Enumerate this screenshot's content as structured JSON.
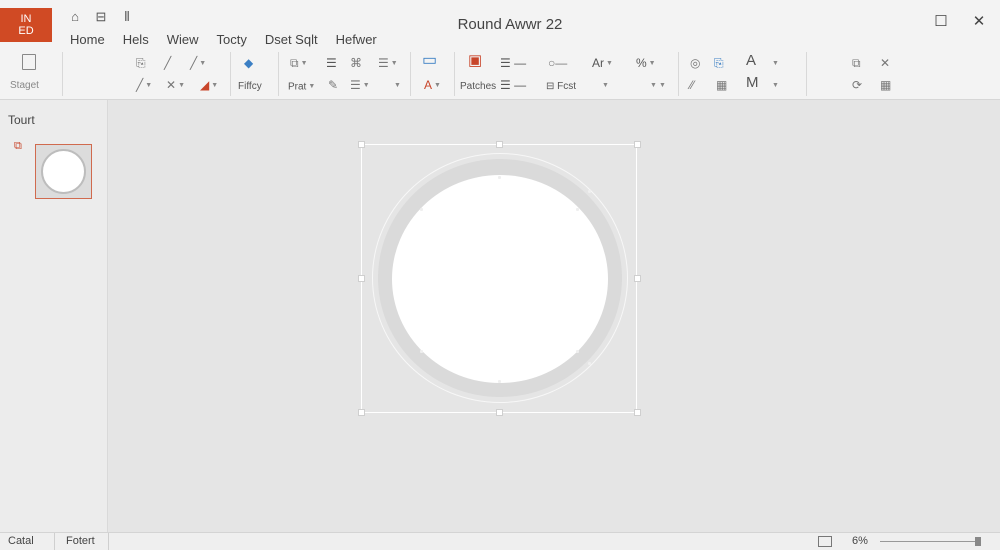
{
  "app": {
    "logo_line1": "IN",
    "logo_line2": "ED",
    "accent": "#d04a24"
  },
  "quick_access": [
    "⌂",
    "⊟",
    "⦀"
  ],
  "window": {
    "title": "Round Awwr 22",
    "maximize_icon": "☐",
    "close_icon": "✕"
  },
  "tabs": [
    "Home",
    "Hels",
    "Wiew",
    "Tocty",
    "Dset Sqlt",
    "Hefwer"
  ],
  "ribbon": {
    "paste_label": "Staget",
    "fancy_label": "Fiffcy",
    "prat_label": "Prat",
    "patches_label": "Patches",
    "font_label": "Fcst",
    "a_label": "Ar",
    "percent_label": "%",
    "big_a": "A",
    "big_m": "M"
  },
  "pane": {
    "title": "Tourt"
  },
  "statusbar": {
    "left1": "Catal",
    "left2": "Fotert",
    "zoom": "6%"
  }
}
